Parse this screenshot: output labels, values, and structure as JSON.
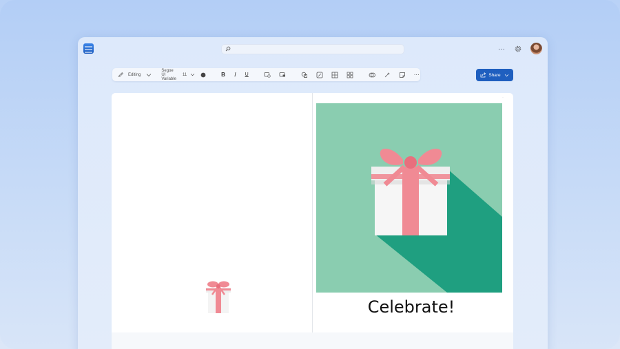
{
  "app": {
    "search_placeholder": "",
    "more_label": "···"
  },
  "toolbar": {
    "mode_label": "Editing",
    "font_name": "Segoe UI Variable",
    "font_size": "11",
    "bold_label": "B",
    "italic_label": "I",
    "underline_label": "U",
    "more_label": "···"
  },
  "share": {
    "label": "Share"
  },
  "document": {
    "cover_text": "Celebrate!"
  },
  "colors": {
    "cover_bg": "#8acdb0",
    "cover_shadow": "#1f9f80",
    "ribbon": "#f08a94",
    "box": "#f7f7f7",
    "accent": "#1f5fbf"
  }
}
